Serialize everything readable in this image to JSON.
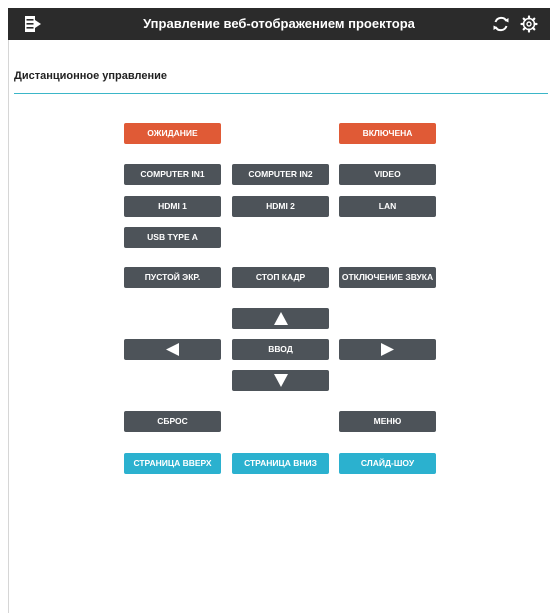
{
  "header": {
    "title": "Управление веб-отображением проектора",
    "menu_icon": "menu-icon",
    "refresh_icon": "refresh-icon",
    "settings_icon": "settings-icon"
  },
  "section": {
    "title": "Дистанционное управление"
  },
  "power": {
    "standby": "ОЖИДАНИЕ",
    "on": "ВКЛЮЧЕНА"
  },
  "inputs": {
    "computer_in1": "COMPUTER IN1",
    "computer_in2": "COMPUTER IN2",
    "video": "VIDEO",
    "hdmi1": "HDMI 1",
    "hdmi2": "HDMI 2",
    "lan": "LAN",
    "usb_type_a": "USB TYPE A"
  },
  "functions": {
    "blank": "ПУСТОЙ ЭКР.",
    "freeze": "СТОП КАДР",
    "mute": "ОТКЛЮЧЕНИЕ ЗВУКА"
  },
  "navigation": {
    "enter": "ВВОД",
    "up_icon": "arrow-up-icon",
    "down_icon": "arrow-down-icon",
    "left_icon": "arrow-left-icon",
    "right_icon": "arrow-right-icon"
  },
  "misc": {
    "reset": "СБРОС",
    "menu": "МЕНЮ"
  },
  "pages": {
    "page_up": "СТРАНИЦА ВВЕРХ",
    "page_down": "СТРАНИЦА ВНИЗ",
    "slideshow": "СЛАЙД-ШОУ"
  },
  "colors": {
    "topbar": "#2b2b2b",
    "button_dark": "#4d5359",
    "button_power": "#e05a36",
    "button_page": "#2bb1cf",
    "divider": "#3bb6c8"
  }
}
